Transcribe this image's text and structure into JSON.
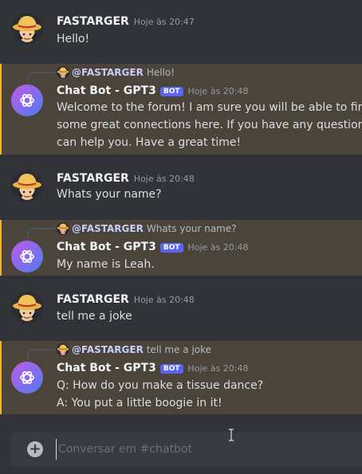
{
  "colors": {
    "background": "#313338",
    "highlight": "#4a443a",
    "accent_bar": "#f0b232",
    "bot_badge": "#5865f2",
    "mention": "#c9cdfb"
  },
  "messages": [
    {
      "author": "FASTARGER",
      "timestamp": "Hoje às 20:47",
      "text": "Hello!",
      "avatar_icon": "straw-hat-avatar-icon"
    },
    {
      "reply_to": {
        "mention": "@FASTARGER",
        "preview": "Hello!"
      },
      "author": "Chat Bot - GPT3",
      "badge": "BOT",
      "timestamp": "Hoje às 20:48",
      "lines": [
        "Welcome to the forum! I am sure you will be able to find a",
        "some great connections here. If you have any questions, p",
        "can help you. Have a great time!"
      ],
      "avatar_icon": "openai-logo-icon"
    },
    {
      "author": "FASTARGER",
      "timestamp": "Hoje às 20:48",
      "text": "Whats your name?",
      "avatar_icon": "straw-hat-avatar-icon"
    },
    {
      "reply_to": {
        "mention": "@FASTARGER",
        "preview": "Whats your name?"
      },
      "author": "Chat Bot - GPT3",
      "badge": "BOT",
      "timestamp": "Hoje às 20:48",
      "lines": [
        "My name is Leah."
      ],
      "avatar_icon": "openai-logo-icon"
    },
    {
      "author": "FASTARGER",
      "timestamp": "Hoje às 20:48",
      "text": "tell me a joke",
      "avatar_icon": "straw-hat-avatar-icon"
    },
    {
      "reply_to": {
        "mention": "@FASTARGER",
        "preview": "tell me a joke"
      },
      "author": "Chat Bot - GPT3",
      "badge": "BOT",
      "timestamp": "Hoje às 20:48",
      "lines": [
        "Q: How do you make a tissue dance?",
        "A: You put a little boogie in it!"
      ],
      "avatar_icon": "openai-logo-icon"
    }
  ],
  "composer": {
    "placeholder": "Conversar em #chatbot",
    "plus_icon": "add-attachment-icon"
  }
}
